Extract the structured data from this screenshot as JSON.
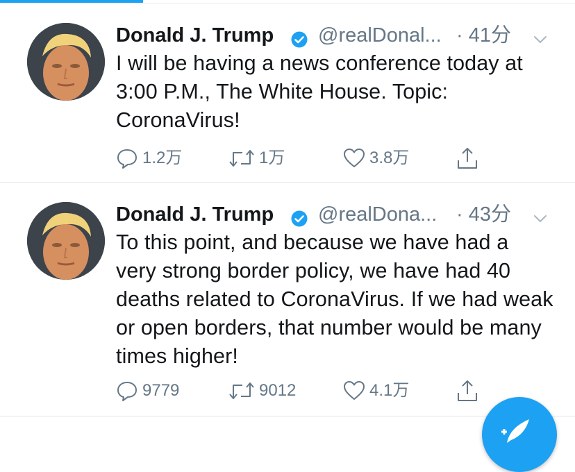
{
  "tweets": [
    {
      "name": "Donald J. Trump",
      "handle": "@realDonal...",
      "time": "· 41分",
      "text": "I will be having a news conference today at 3:00 P.M., The White House. Topic: CoronaVirus!",
      "reply_count": "1.2万",
      "retweet_count": "1万",
      "like_count": "3.8万"
    },
    {
      "name": "Donald J. Trump",
      "handle": "@realDona...",
      "time": "· 43分",
      "text": "To this point, and because we have had a very strong border policy, we have had 40 deaths related to CoronaVirus. If we had weak or open borders, that number would be many times higher!",
      "reply_count": "9779",
      "retweet_count": "9012",
      "like_count": "4.1万"
    }
  ],
  "icons": {
    "verified": "verified-badge-icon",
    "chevron": "chevron-down-icon",
    "reply": "reply-icon",
    "retweet": "retweet-icon",
    "like": "heart-icon",
    "share": "share-icon",
    "compose": "compose-tweet-icon"
  },
  "colors": {
    "accent": "#1da1f2",
    "secondary_text": "#657786",
    "primary_text": "#14171a",
    "divider": "#e1e8ed"
  }
}
